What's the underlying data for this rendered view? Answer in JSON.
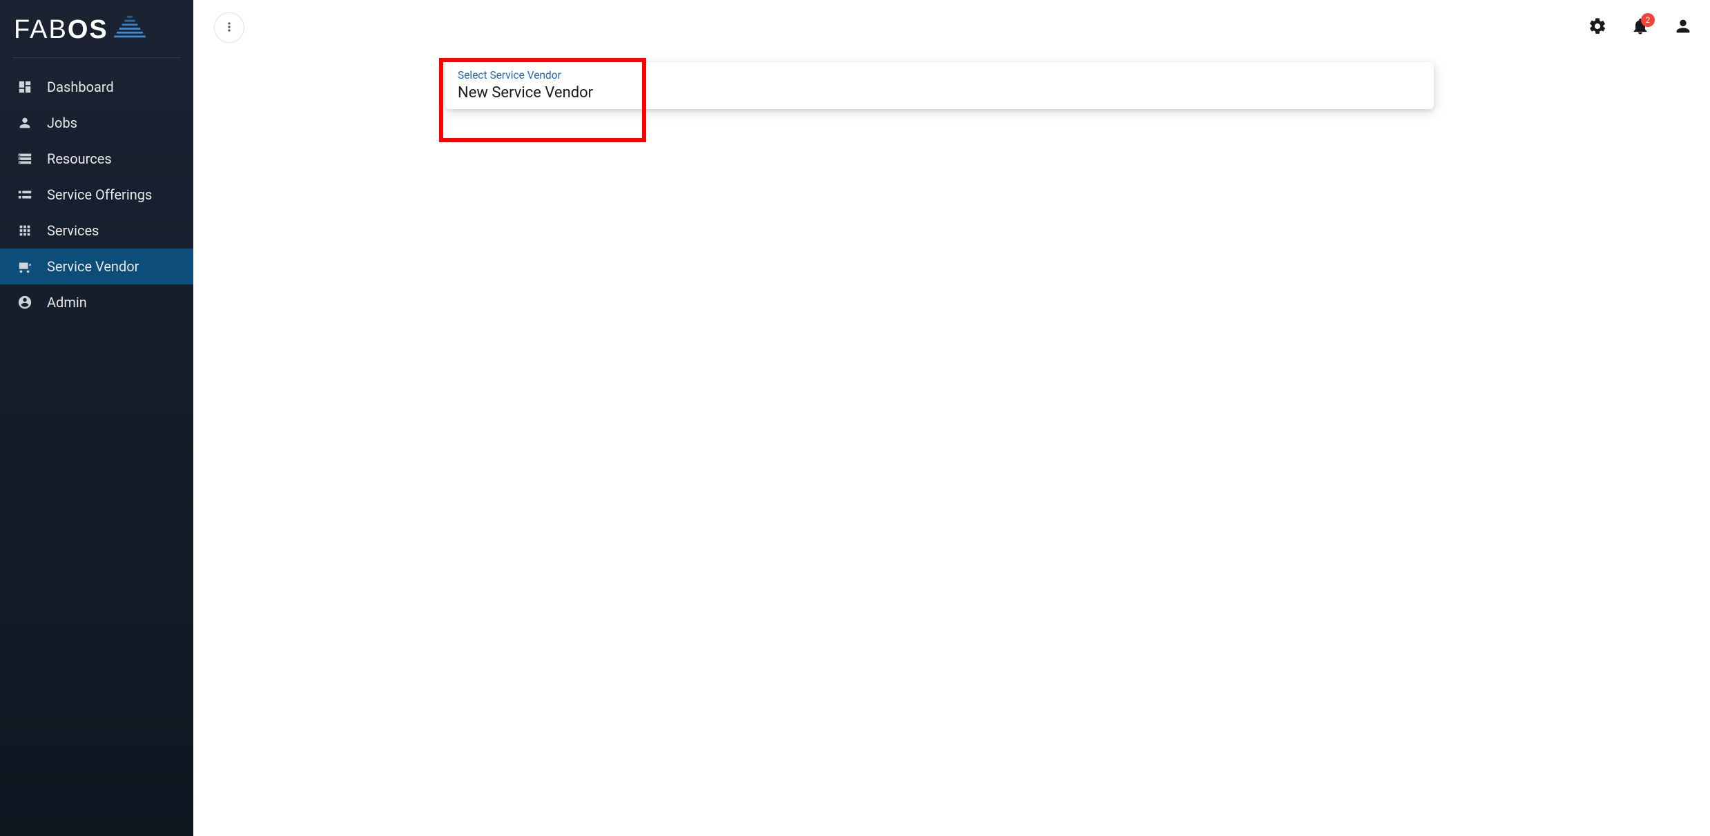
{
  "brand": {
    "name_part1": "FAB",
    "name_part2": "OS"
  },
  "sidebar": {
    "items": [
      {
        "label": "Dashboard"
      },
      {
        "label": "Jobs"
      },
      {
        "label": "Resources"
      },
      {
        "label": "Service Offerings"
      },
      {
        "label": "Services"
      },
      {
        "label": "Service Vendor"
      },
      {
        "label": "Admin"
      }
    ]
  },
  "topbar": {
    "notifications_count": "2"
  },
  "main": {
    "select_label": "Select Service Vendor",
    "select_value": "New Service Vendor"
  }
}
